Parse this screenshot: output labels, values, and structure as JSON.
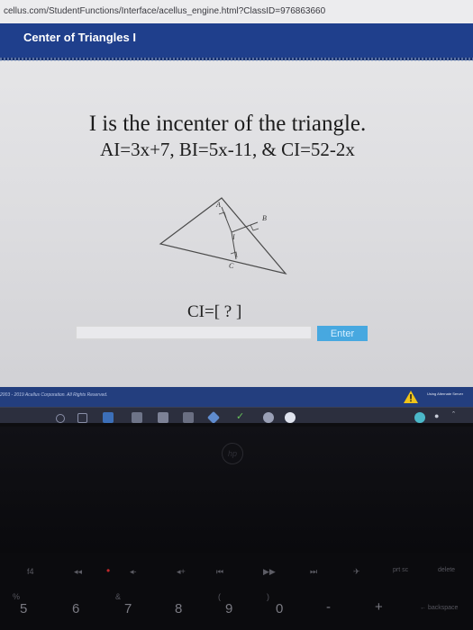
{
  "browser": {
    "url": "cellus.com/StudentFunctions/Interface/acellus_engine.html?ClassID=976863660"
  },
  "lesson": {
    "title": "Center of Triangles I"
  },
  "question": {
    "line1": "I is the incenter of the triangle.",
    "line2": "AI=3x+7, BI=5x-11, & CI=52-2x",
    "prompt": "CI=[ ? ]"
  },
  "diagram": {
    "labels": {
      "a": "A",
      "b": "B",
      "c": "C",
      "i": "I"
    }
  },
  "answer": {
    "value": "",
    "enter_label": "Enter"
  },
  "footer": {
    "copyright": "2003 - 2019 Acellus Corporation.  All Rights Reserved.",
    "feedback": "Using Alternate Server"
  },
  "taskbar": {
    "icons": [
      "search-icon",
      "task-view-icon",
      "explorer-icon",
      "store-icon",
      "mail-icon",
      "office-icon",
      "dropbox-icon",
      "app-icon",
      "chrome-icon"
    ]
  },
  "keyboard": {
    "function_row": [
      "f4",
      "◂◂",
      "•",
      "◂-",
      "◂+",
      "⏮",
      "▶▶",
      "⏭",
      "✈",
      "prt sc",
      "delete"
    ],
    "number_row": [
      "5",
      "6",
      "7",
      "8",
      "9",
      "0",
      "-",
      "+",
      "← backspace"
    ],
    "number_shift": [
      "%",
      "",
      "&",
      "*",
      "(",
      ")"
    ]
  },
  "colors": {
    "header": "#1f3f8c",
    "enter": "#47a8e0",
    "footer": "#233e7e",
    "taskbar": "#2c2f3e"
  }
}
